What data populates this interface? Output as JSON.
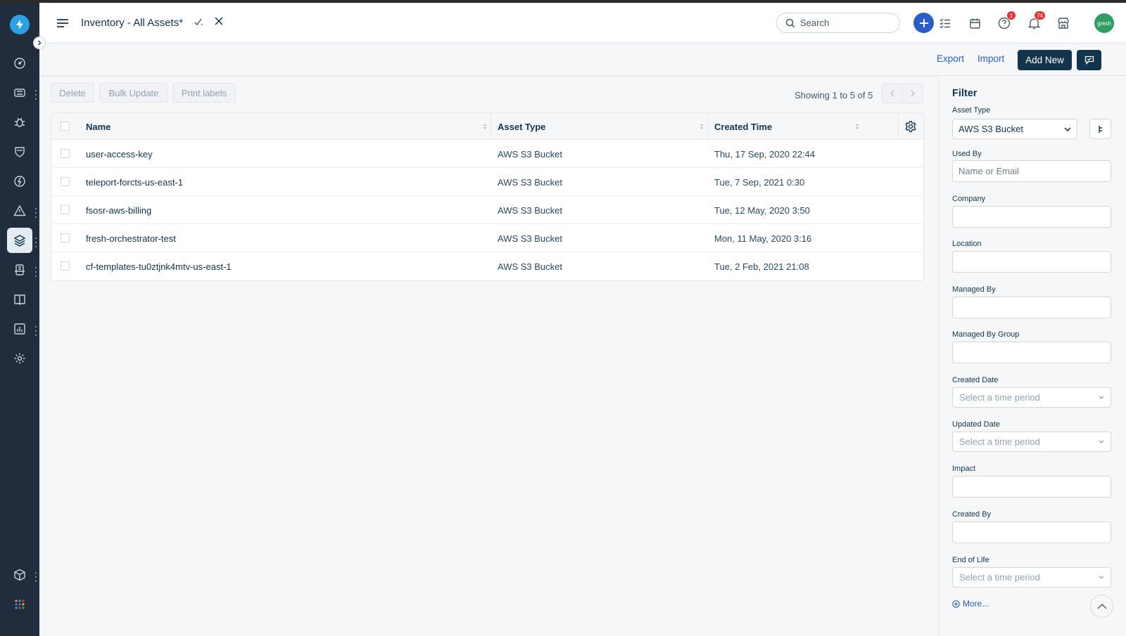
{
  "header": {
    "title": "Inventory - All Assets*",
    "search_placeholder": "Search",
    "help_badge": "1",
    "notif_badge": "74",
    "avatar_text": "gresh"
  },
  "subheader": {
    "export_label": "Export",
    "import_label": "Import",
    "add_new_label": "Add New"
  },
  "toolbar": {
    "delete_label": "Delete",
    "bulk_update_label": "Bulk Update",
    "print_labels_label": "Print labels",
    "showing_text": "Showing 1 to 5 of 5"
  },
  "table": {
    "columns": [
      "Name",
      "Asset Type",
      "Created Time"
    ],
    "rows": [
      {
        "name": "user-access-key",
        "type": "AWS S3 Bucket",
        "created": "Thu, 17 Sep, 2020 22:44"
      },
      {
        "name": "teleport-forcts-us-east-1",
        "type": "AWS S3 Bucket",
        "created": "Tue, 7 Sep, 2021 0:30"
      },
      {
        "name": "fsosr-aws-billing",
        "type": "AWS S3 Bucket",
        "created": "Tue, 12 May, 2020 3:50"
      },
      {
        "name": "fresh-orchestrator-test",
        "type": "AWS S3 Bucket",
        "created": "Mon, 11 May, 2020 3:16"
      },
      {
        "name": "cf-templates-tu0ztjnk4mtv-us-east-1",
        "type": "AWS S3 Bucket",
        "created": "Tue, 2 Feb, 2021 21:08"
      }
    ]
  },
  "filter": {
    "title": "Filter",
    "asset_type_label": "Asset Type",
    "asset_type_value": "AWS S3 Bucket",
    "used_by_label": "Used By",
    "used_by_placeholder": "Name or Email",
    "company_label": "Company",
    "location_label": "Location",
    "managed_by_label": "Managed By",
    "managed_by_group_label": "Managed By Group",
    "created_date_label": "Created Date",
    "updated_date_label": "Updated Date",
    "impact_label": "Impact",
    "created_by_label": "Created By",
    "end_of_life_label": "End of Life",
    "time_period_placeholder": "Select a time period",
    "more_label": "More..."
  },
  "colors": {
    "nav_bg": "#1f2d3d",
    "primary": "#12344d",
    "accent": "#2c5cc5",
    "badge": "#e43538"
  }
}
